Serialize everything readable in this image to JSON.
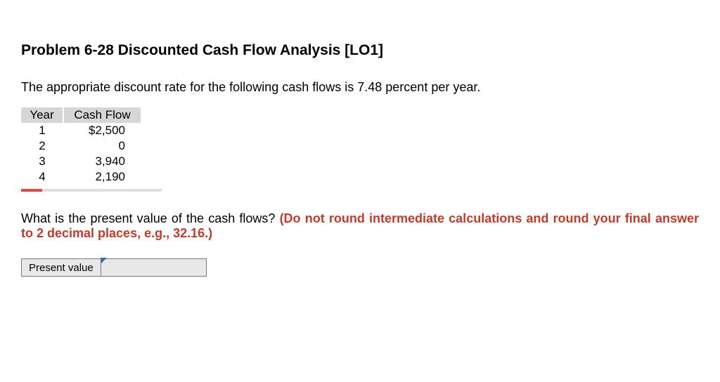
{
  "title": "Problem 6-28 Discounted Cash Flow Analysis [LO1]",
  "intro": "The appropriate discount rate for the following cash flows is 7.48 percent per year.",
  "table": {
    "headers": {
      "year": "Year",
      "flow": "Cash Flow"
    },
    "rows": [
      {
        "year": "1",
        "flow": "$2,500"
      },
      {
        "year": "2",
        "flow": "0"
      },
      {
        "year": "3",
        "flow": "3,940"
      },
      {
        "year": "4",
        "flow": "2,190"
      }
    ]
  },
  "question_plain": "What is the present value of the cash flows? ",
  "question_red": "(Do not round intermediate calculations and round your final answer to 2 decimal places, e.g., 32.16.)",
  "answer": {
    "label": "Present value",
    "value": ""
  }
}
